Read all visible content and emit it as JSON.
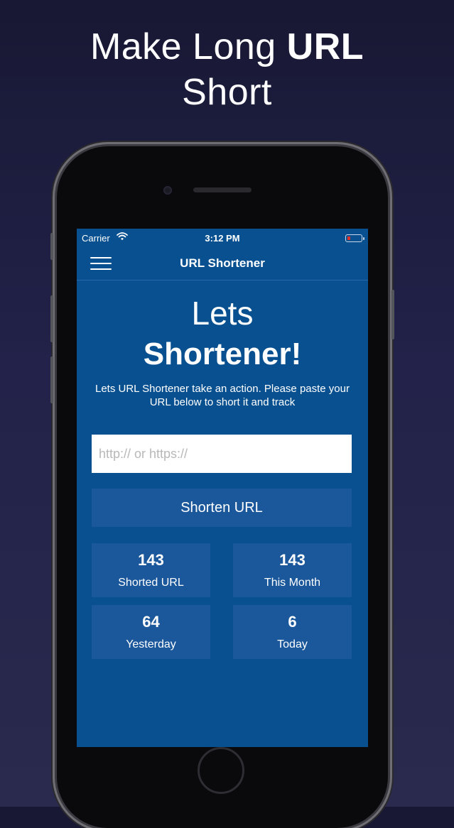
{
  "promo": {
    "line1_regular": "Make Long ",
    "line1_bold": "URL",
    "line2": "Short"
  },
  "status_bar": {
    "carrier": "Carrier",
    "time": "3:12 PM"
  },
  "nav": {
    "title": "URL Shortener"
  },
  "hero": {
    "line1": "Lets",
    "line2": "Shortener!",
    "description": "Lets URL Shortener take an action. Please paste your URL below to short it and track"
  },
  "form": {
    "url_placeholder": "http:// or https://",
    "url_value": "",
    "shorten_label": "Shorten URL"
  },
  "stats": [
    {
      "value": "143",
      "label": "Shorted URL"
    },
    {
      "value": "143",
      "label": "This Month"
    },
    {
      "value": "64",
      "label": "Yesterday"
    },
    {
      "value": "6",
      "label": "Today"
    }
  ],
  "colors": {
    "screen_bg": "#085090",
    "card_bg": "#1a579b",
    "battery_low": "#e0302a"
  }
}
